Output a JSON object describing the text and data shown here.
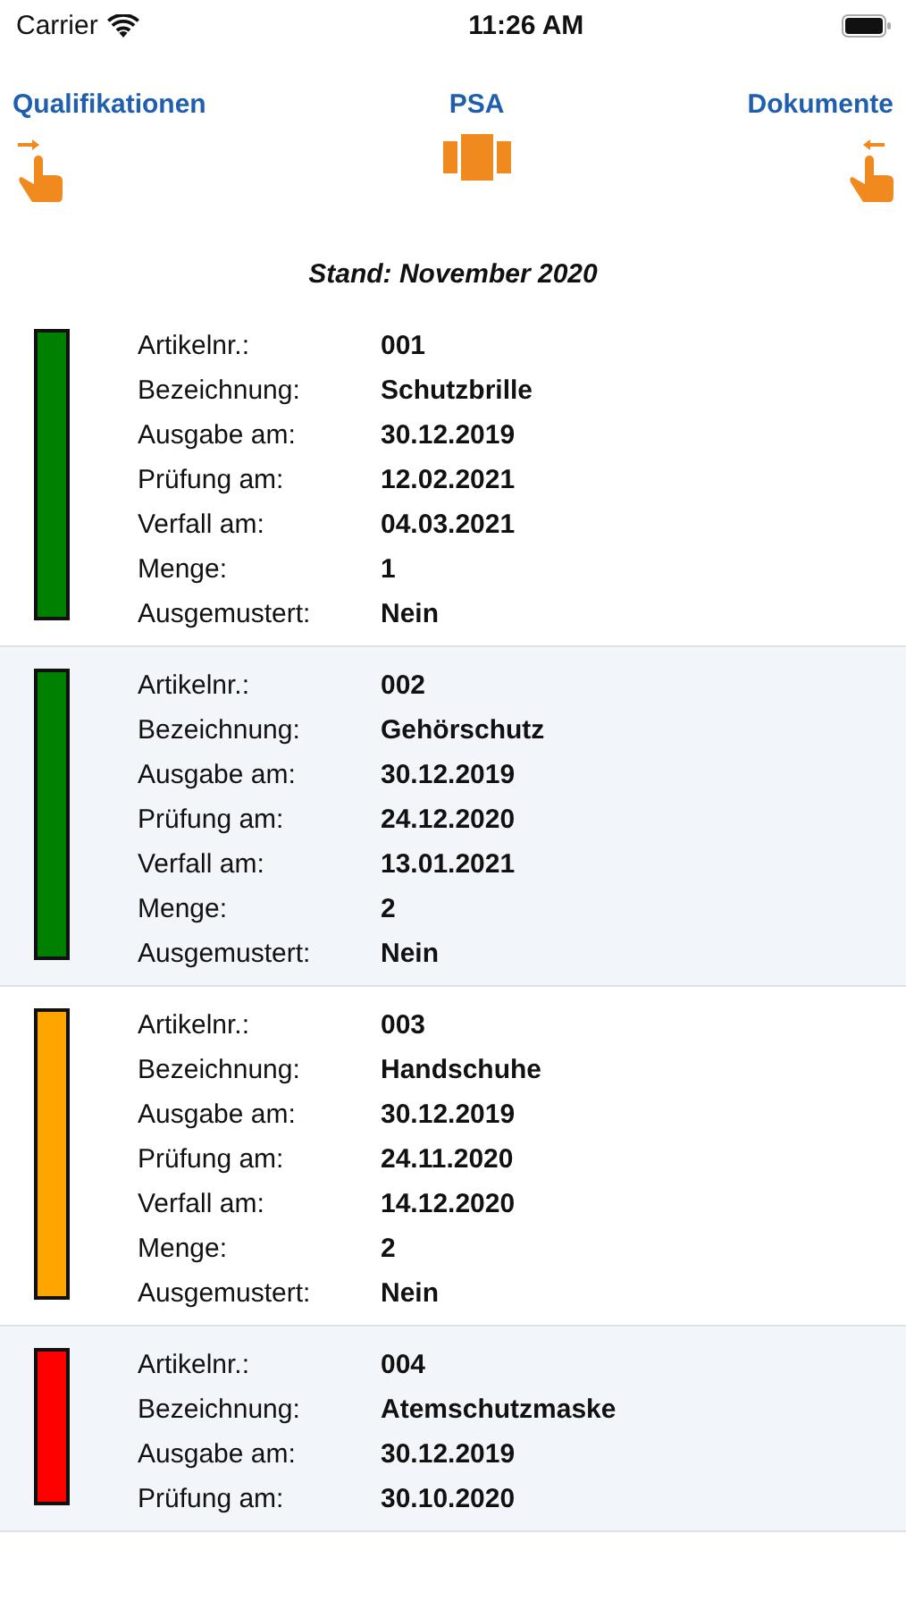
{
  "status_bar": {
    "carrier": "Carrier",
    "time": "11:26 AM"
  },
  "nav": {
    "left": "Qualifikationen",
    "center": "PSA",
    "right": "Dokumente"
  },
  "stand": "Stand: November 2020",
  "items": [
    {
      "color": "#008000",
      "fields": [
        {
          "label": "Artikelnr.:",
          "value": "001"
        },
        {
          "label": "Bezeichnung:",
          "value": "Schutzbrille"
        },
        {
          "label": "Ausgabe am:",
          "value": "30.12.2019"
        },
        {
          "label": "Prüfung am:",
          "value": "12.02.2021"
        },
        {
          "label": "Verfall am:",
          "value": "04.03.2021"
        },
        {
          "label": "Menge:",
          "value": "1"
        },
        {
          "label": "Ausgemustert:",
          "value": "Nein"
        }
      ]
    },
    {
      "color": "#008000",
      "fields": [
        {
          "label": "Artikelnr.:",
          "value": "002"
        },
        {
          "label": "Bezeichnung:",
          "value": "Gehörschutz"
        },
        {
          "label": "Ausgabe am:",
          "value": "30.12.2019"
        },
        {
          "label": "Prüfung am:",
          "value": "24.12.2020"
        },
        {
          "label": "Verfall am:",
          "value": "13.01.2021"
        },
        {
          "label": "Menge:",
          "value": "2"
        },
        {
          "label": "Ausgemustert:",
          "value": "Nein"
        }
      ]
    },
    {
      "color": "#ffa500",
      "fields": [
        {
          "label": "Artikelnr.:",
          "value": "003"
        },
        {
          "label": "Bezeichnung:",
          "value": "Handschuhe"
        },
        {
          "label": "Ausgabe am:",
          "value": "30.12.2019"
        },
        {
          "label": "Prüfung am:",
          "value": "24.11.2020"
        },
        {
          "label": "Verfall am:",
          "value": "14.12.2020"
        },
        {
          "label": "Menge:",
          "value": "2"
        },
        {
          "label": "Ausgemustert:",
          "value": "Nein"
        }
      ]
    },
    {
      "color": "#ff0000",
      "fields": [
        {
          "label": "Artikelnr.:",
          "value": "004"
        },
        {
          "label": "Bezeichnung:",
          "value": "Atemschutzmaske"
        },
        {
          "label": "Ausgabe am:",
          "value": "30.12.2019"
        },
        {
          "label": "Prüfung am:",
          "value": "30.10.2020"
        }
      ]
    }
  ]
}
